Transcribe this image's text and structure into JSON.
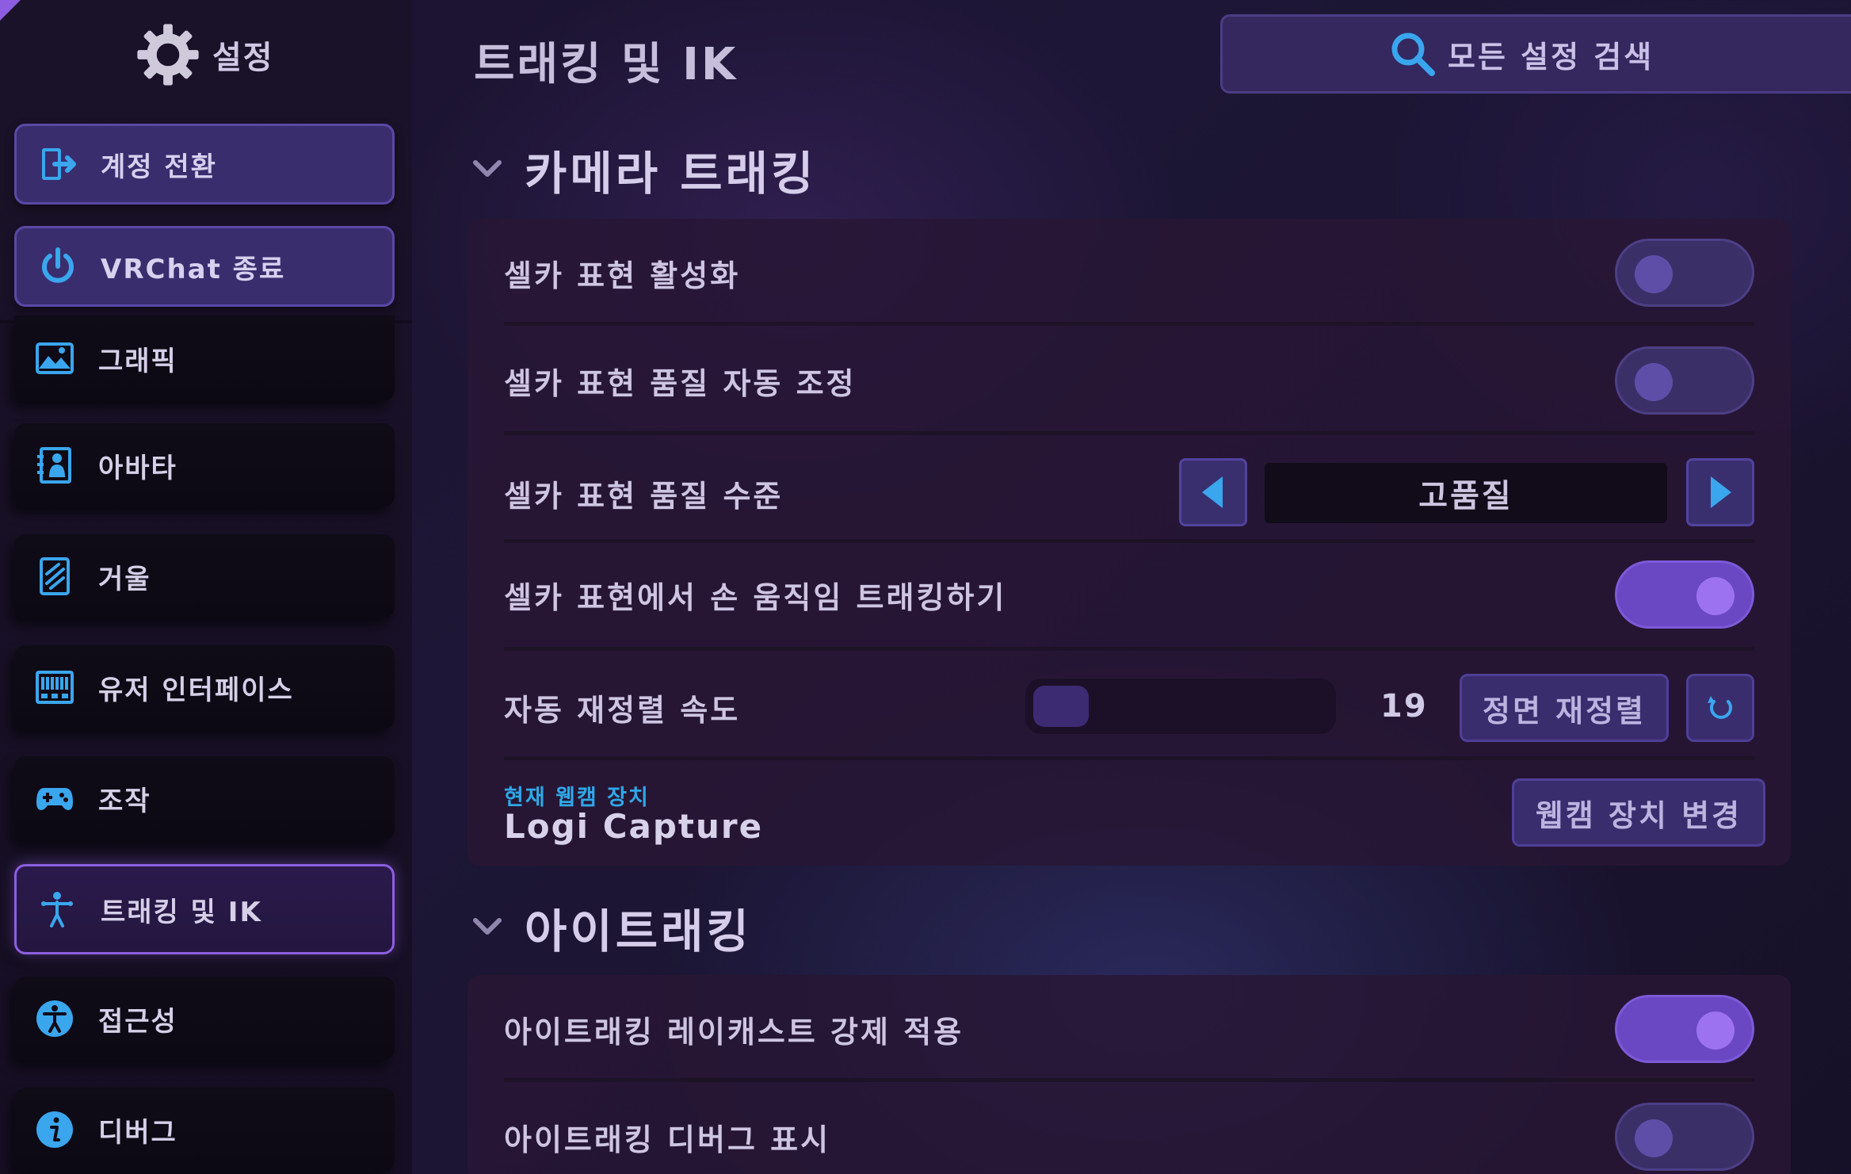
{
  "sidebar": {
    "title": "설정",
    "account_buttons": [
      {
        "label": "계정 전환",
        "icon": "switch-account-icon"
      },
      {
        "label": "VRChat 종료",
        "icon": "power-icon"
      }
    ],
    "items": [
      {
        "label": "그래픽",
        "icon": "graphics-icon"
      },
      {
        "label": "아바타",
        "icon": "avatar-icon"
      },
      {
        "label": "거울",
        "icon": "mirror-icon"
      },
      {
        "label": "유저 인터페이스",
        "icon": "ui-icon"
      },
      {
        "label": "조작",
        "icon": "gamepad-icon"
      },
      {
        "label": "트래킹 및 IK",
        "icon": "tracking-icon",
        "active": true
      },
      {
        "label": "접근성",
        "icon": "accessibility-icon"
      },
      {
        "label": "디버그",
        "icon": "info-icon"
      }
    ]
  },
  "header": {
    "title": "트래킹 및 IK",
    "search_label": "모든 설정 검색"
  },
  "camera_section": {
    "title": "카메라 트래킹",
    "rows": {
      "selfie_enable": {
        "label": "셀카 표현 활성화",
        "on": false
      },
      "selfie_auto_quality": {
        "label": "셀카 표현 품질 자동 조정",
        "on": false
      },
      "selfie_quality_level": {
        "label": "셀카 표현 품질 수준",
        "value": "고품질"
      },
      "selfie_hand_tracking": {
        "label": "셀카 표현에서 손 움직임 트래킹하기",
        "on": true
      },
      "auto_recenter": {
        "label": "자동 재정렬 속도",
        "value": "19",
        "fraction": 0.19,
        "button": "정면 재정렬"
      }
    },
    "webcam": {
      "caption": "현재 웹캠 장치",
      "device": "Logi Capture",
      "button": "웹캠 장치 변경"
    }
  },
  "eye_section": {
    "title": "아이트래킹",
    "rows": {
      "force_raycast": {
        "label": "아이트래킹 레이캐스트 강제 적용",
        "on": true
      },
      "debug_display": {
        "label": "아이트래킹 디버그 표시",
        "on": false
      }
    }
  },
  "colors": {
    "accent": "#8c5fe0",
    "icon_blue": "#3aa6ee",
    "caption_blue": "#2fa8e8"
  }
}
